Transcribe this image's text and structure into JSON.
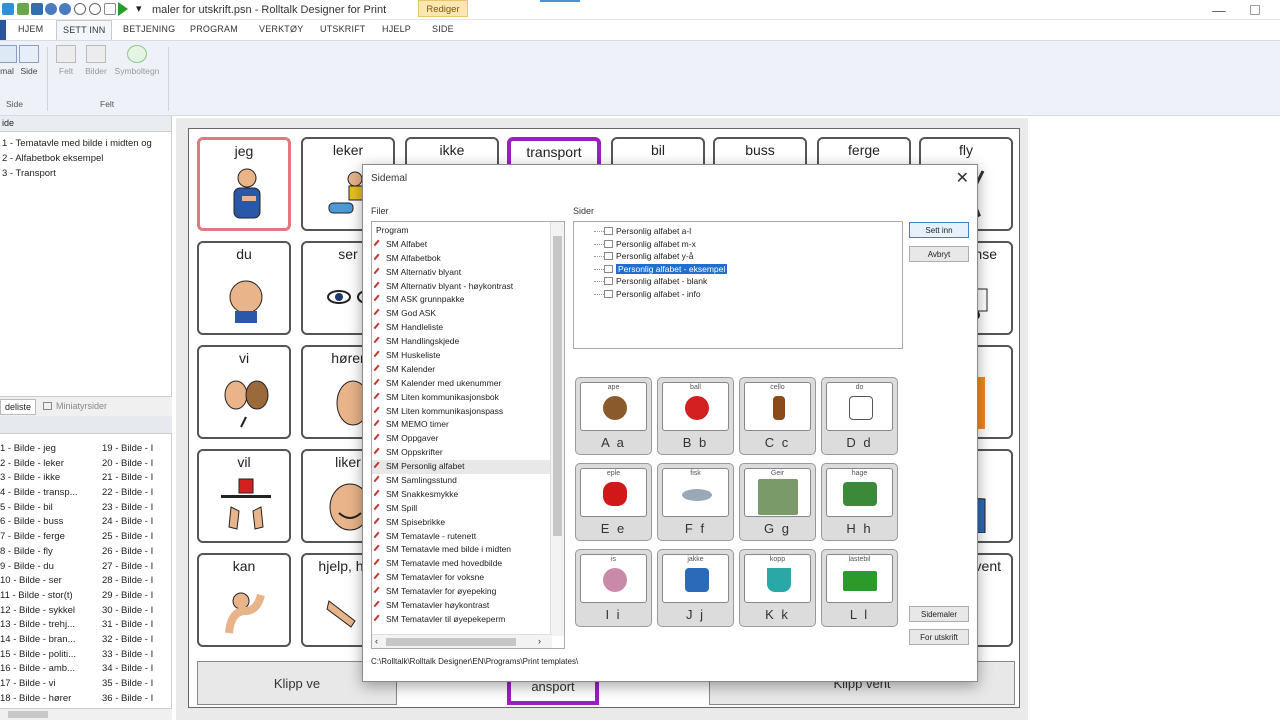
{
  "window": {
    "title": "maler for utskrift.psn - Rolltalk Designer for Print",
    "context_tab": "Rediger"
  },
  "ribbon": {
    "tabs": [
      "HJEM",
      "SETT INN",
      "BETJENING",
      "PROGRAM",
      "VERKTØY",
      "UTSKRIFT",
      "HJELP",
      "SIDE"
    ],
    "active_tab": "SETT INN",
    "buttons": [
      {
        "label": "Sidemal",
        "display": "mal",
        "enabled": true
      },
      {
        "label": "Side",
        "enabled": true
      },
      {
        "label": "Felt",
        "enabled": false
      },
      {
        "label": "Bilder",
        "enabled": false
      },
      {
        "label": "Symboltegn",
        "enabled": false
      }
    ],
    "groups": [
      "Side",
      "Felt"
    ]
  },
  "left_panel": {
    "header": "ide",
    "pages": [
      "1 - Tematavle med bilde i midten og",
      "2 - Alfabetbok eksempel",
      "3 - Transport"
    ],
    "tabs": [
      "deliste",
      "Miniatyrsider"
    ],
    "images_left": [
      "1 - Bilde - jeg",
      "2 - Bilde - leker",
      "3 - Bilde - ikke",
      "4 - Bilde - transp...",
      "5 - Bilde - bil",
      "6 - Bilde - buss",
      "7 - Bilde - ferge",
      "8 - Bilde - fly",
      "9 - Bilde - du",
      "10 - Bilde - ser",
      "11 - Bilde - stor(t)",
      "12 - Bilde - sykkel",
      "13 - Bilde - trehj...",
      "14 - Bilde - bran...",
      "15 - Bilde - politi...",
      "16 - Bilde - amb...",
      "17 - Bilde - vi",
      "18 - Bilde - hører"
    ],
    "images_right": [
      "19 - Bilde - I",
      "20 - Bilde - I",
      "21 - Bilde - I",
      "22 - Bilde - I",
      "23 - Bilde - I",
      "24 - Bilde - I",
      "25 - Bilde - I",
      "26 - Bilde - I",
      "27 - Bilde - I",
      "28 - Bilde - I",
      "29 - Bilde - I",
      "30 - Bilde - I",
      "31 - Bilde - I",
      "32 - Bilde - I",
      "33 - Bilde - I",
      "34 - Bilde - I",
      "35 - Bilde - I",
      "36 - Bilde - I"
    ]
  },
  "board": {
    "row1": [
      "jeg",
      "leker",
      "ikke",
      "transport",
      "bil",
      "buss",
      "ferge",
      "fly"
    ],
    "col1": [
      "du",
      "vi",
      "vil",
      "kan"
    ],
    "col2": [
      "ser",
      "hører",
      "liker",
      "hjelp, hjel"
    ],
    "right_partial": [
      "nse",
      "vent"
    ],
    "bottom_left": "Klipp ve",
    "bottom_mid": "ansport",
    "bottom_right": "Klipp vent"
  },
  "dialog": {
    "title": "Sidemal",
    "files_label": "Filer",
    "pages_label": "Sider",
    "files": [
      "Program",
      "SM Alfabet",
      "SM Alfabetbok",
      "SM Alternativ blyant",
      "SM Alternativ blyant - høykontrast",
      "SM ASK grunnpakke",
      "SM God ASK",
      "SM Handleliste",
      "SM Handlingskjede",
      "SM Huskeliste",
      "SM Kalender",
      "SM Kalender med ukenummer",
      "SM Liten kommunikasjonsbok",
      "SM Liten kommunikasjonspass",
      "SM MEMO timer",
      "SM Oppgaver",
      "SM Oppskrifter",
      "SM Personlig alfabet",
      "SM Samlingsstund",
      "SM Snakkesmykke",
      "SM Spill",
      "SM Spisebrikke",
      "SM Tematavle - rutenett",
      "SM Tematavle med bilde i midten",
      "SM Tematavle med hovedbilde",
      "SM Tematavler for voksne",
      "SM Tematavler for øyepeking",
      "SM Tematavler høykontrast",
      "SM Tematavler til øyepekeperm"
    ],
    "selected_file": "SM Personlig alfabet",
    "pages": [
      "Personlig alfabet a-l",
      "Personlig alfabet m-x",
      "Personlig alfabet y-å",
      "Personlig alfabet - eksempel",
      "Personlig alfabet - blank",
      "Personlig alfabet - info"
    ],
    "selected_page": "Personlig alfabet - eksempel",
    "preview_cards": [
      {
        "word": "ape",
        "letters": "A a",
        "color": "#8a5a2b"
      },
      {
        "word": "ball",
        "letters": "B b",
        "color": "#d42020"
      },
      {
        "word": "cello",
        "letters": "C c",
        "color": "#8a4a1a"
      },
      {
        "word": "do",
        "letters": "D d",
        "color": "#d8d8d8"
      },
      {
        "word": "eple",
        "letters": "E e",
        "color": "#d01818"
      },
      {
        "word": "fisk",
        "letters": "F f",
        "color": "#9aa8b8"
      },
      {
        "word": "Geir",
        "letters": "G g",
        "color": "#7a9a6a"
      },
      {
        "word": "hage",
        "letters": "H h",
        "color": "#3a8a3a"
      },
      {
        "word": "is",
        "letters": "I i",
        "color": "#c88aa8"
      },
      {
        "word": "jakke",
        "letters": "J j",
        "color": "#2a6ab8"
      },
      {
        "word": "kopp",
        "letters": "K k",
        "color": "#2aa8a8"
      },
      {
        "word": "lastebil",
        "letters": "L l",
        "color": "#2a9a2a"
      }
    ],
    "buttons": {
      "insert": "Sett inn",
      "cancel": "Avbryt",
      "templates": "Sidemaler",
      "print": "For utskrift"
    },
    "path": "C:\\Rolltalk\\Rolltalk Designer\\EN\\Programs\\Print templates\\"
  }
}
